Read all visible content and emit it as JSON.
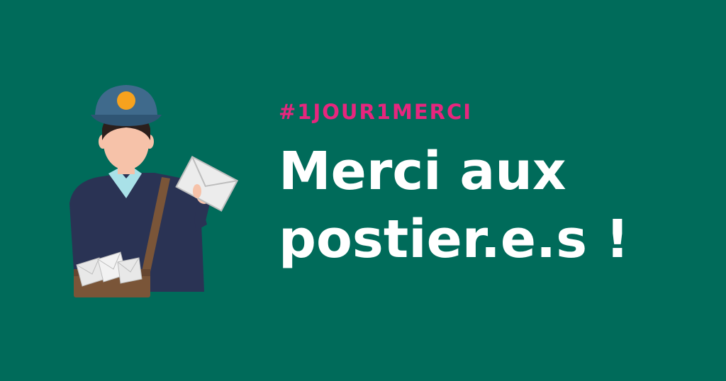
{
  "banner": {
    "hashtag": "#1JOUR1MERCI",
    "headline_line1": "Merci aux",
    "headline_line2": "postier.e.s !"
  },
  "colors": {
    "background": "#006b5a",
    "hashtag": "#e6267e",
    "headline": "#ffffff",
    "cap": "#3f6a8c",
    "badge": "#f6a21e",
    "skin": "#f6c2a9",
    "hair": "#2b1f1c",
    "sweater": "#2a3354",
    "collar": "#a9e1e8",
    "bag": "#7a5538",
    "envelope": "#e8e8e8"
  },
  "illustration": {
    "icon": "postman-icon"
  }
}
